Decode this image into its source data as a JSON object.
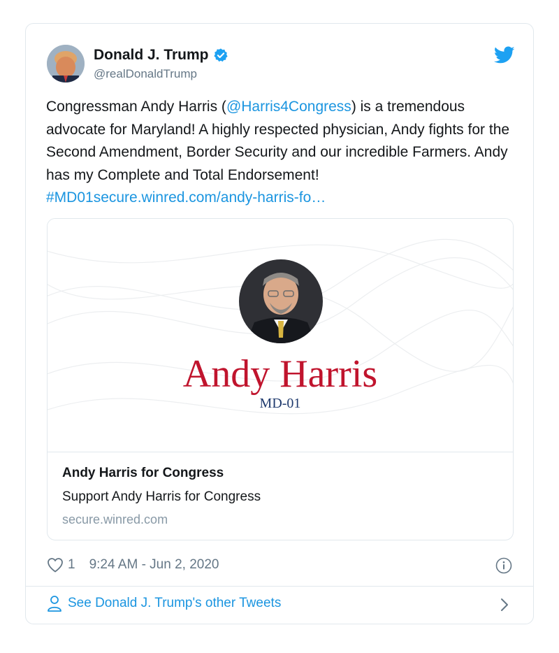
{
  "author": {
    "name": "Donald J. Trump",
    "handle": "@realDonaldTrump"
  },
  "tweet": {
    "text_part1": "Congressman Andy Harris (",
    "mention": "@Harris4Congress",
    "text_part2": ") is a tremendous advocate for Maryland! A highly respected physician, Andy fights for the Second Amendment, Border Security and our incredible Farmers. Andy has my Complete and Total Endorsement!",
    "hashtag_link": "#MD01secure.winred.com/andy-harris-fo…"
  },
  "card": {
    "headline": "Andy Harris",
    "subheadline": "MD-01",
    "title": "Andy Harris for Congress",
    "description": "Support Andy Harris for Congress",
    "domain": "secure.winred.com"
  },
  "meta": {
    "like_count": "1",
    "timestamp": "9:24 AM - Jun 2, 2020"
  },
  "footer": {
    "link_label": "See Donald J. Trump's other Tweets"
  },
  "colors": {
    "link": "#1b95e0",
    "headline_red": "#c0142d",
    "sub_blue": "#1f3a6e"
  },
  "icons": [
    "verified-badge-icon",
    "twitter-bird-icon",
    "heart-icon",
    "info-icon",
    "person-icon",
    "chevron-right-icon"
  ]
}
